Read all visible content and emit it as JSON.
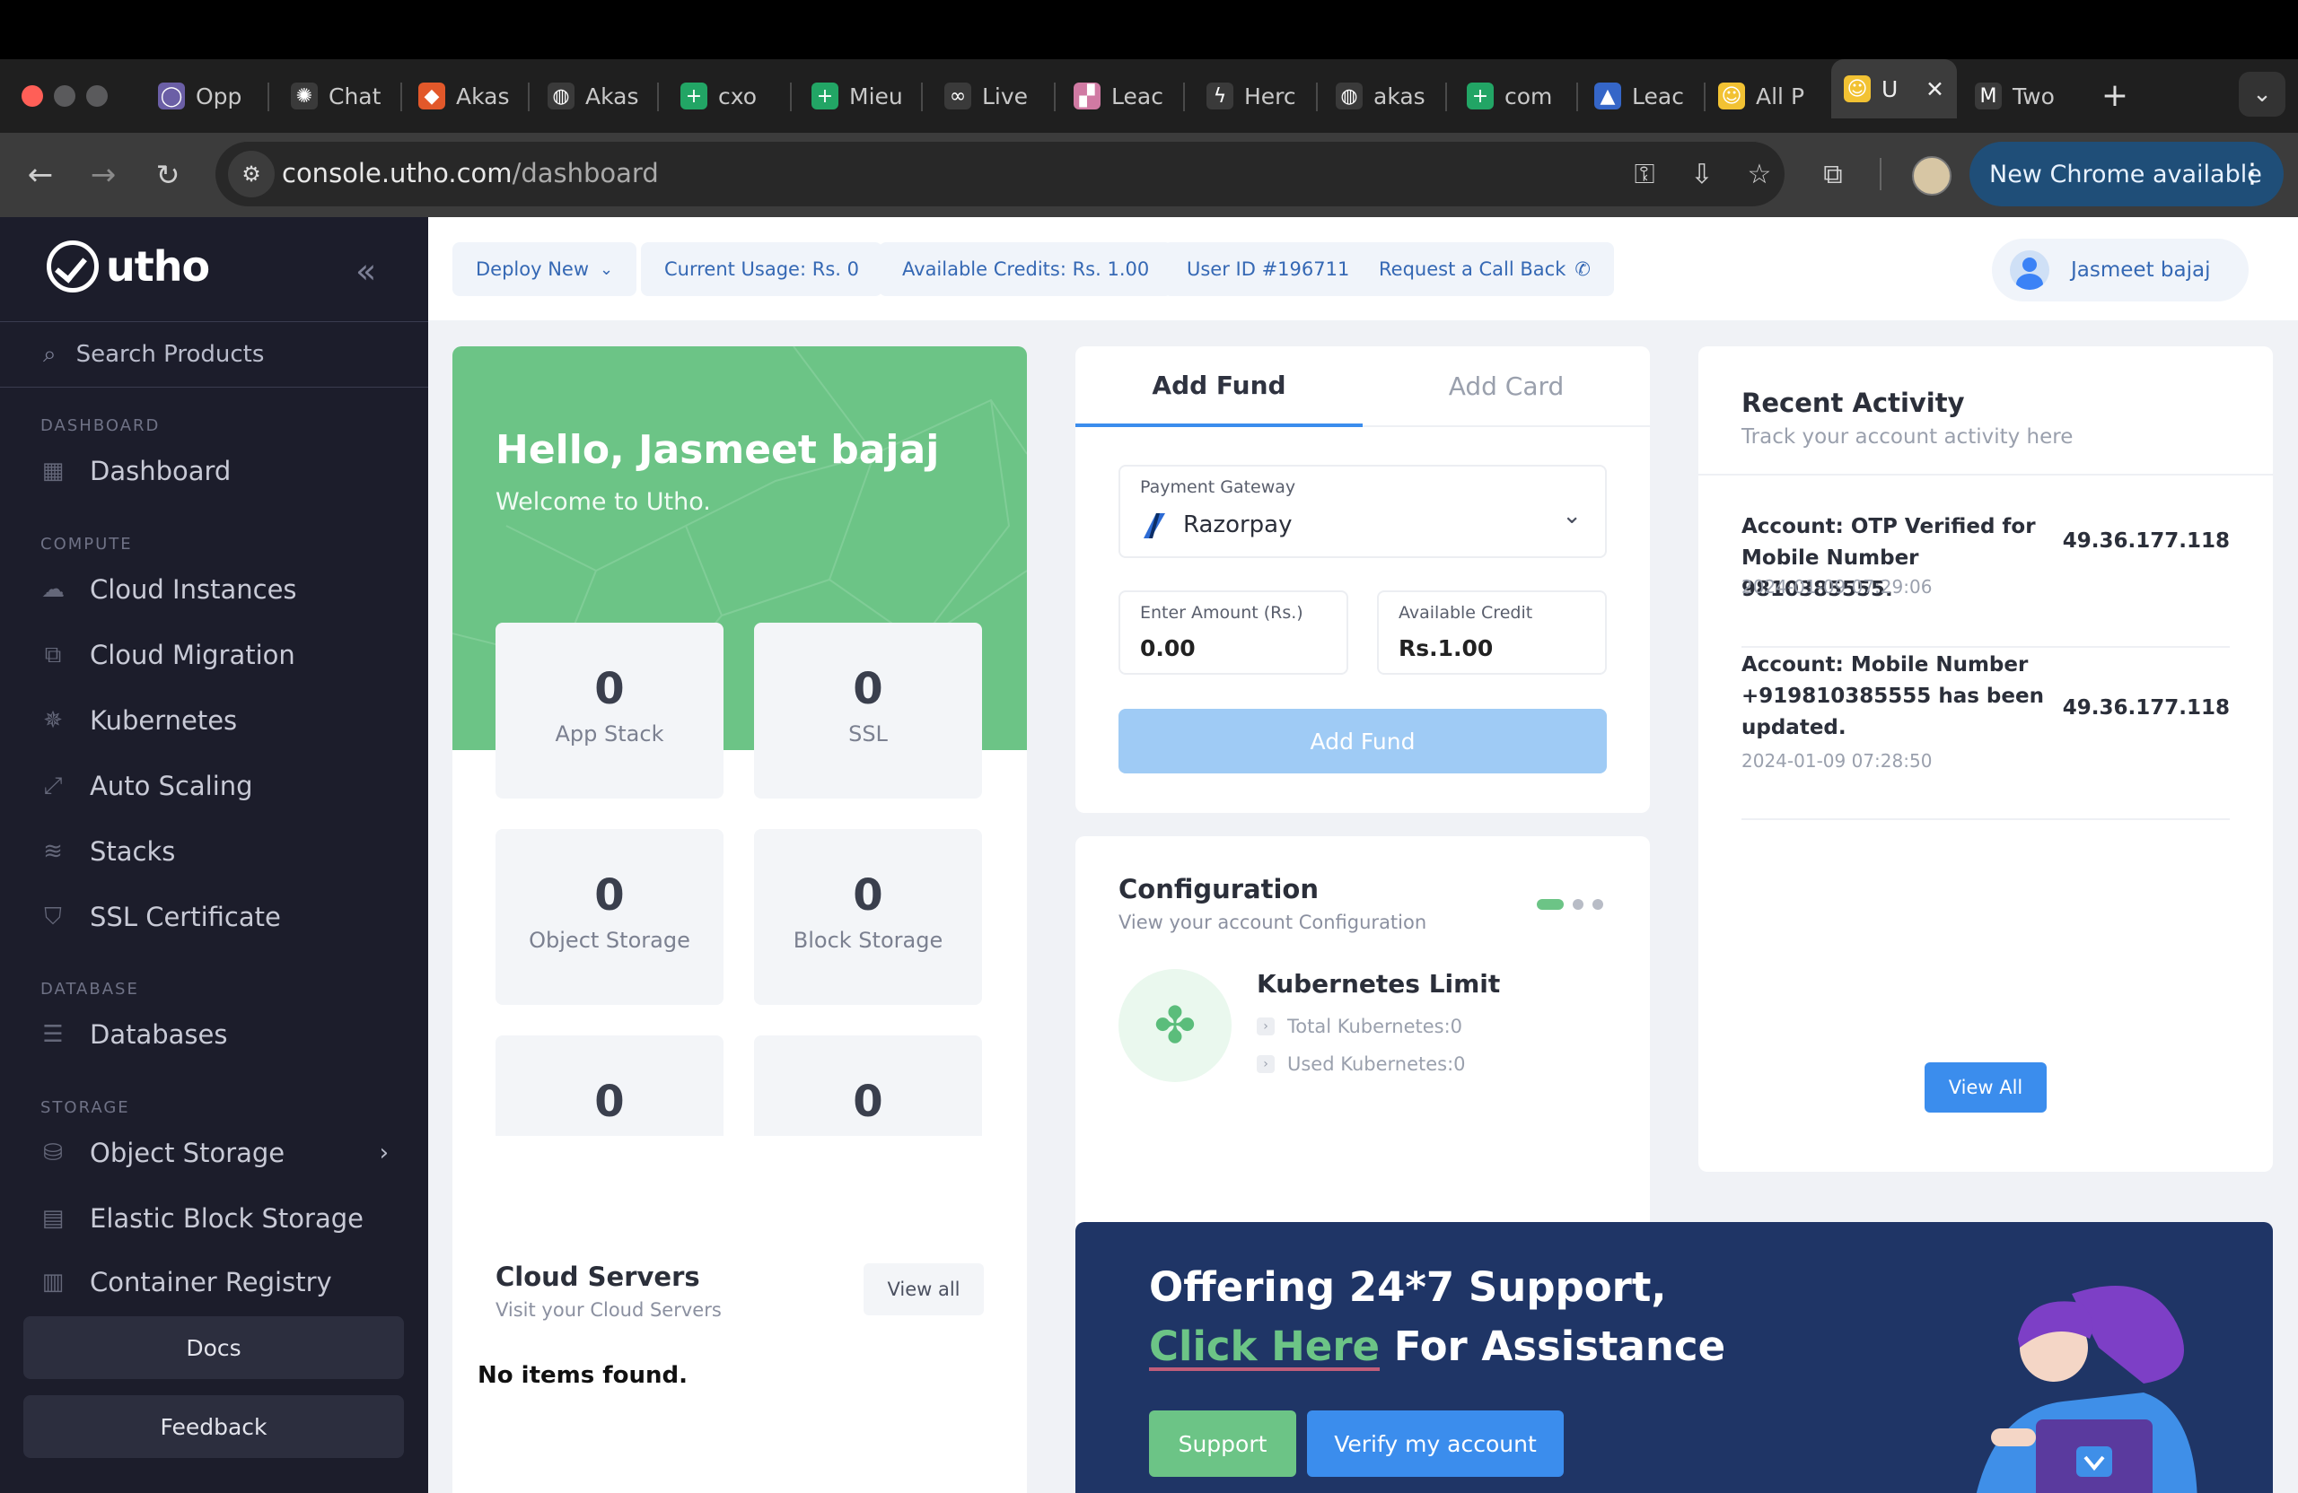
{
  "browser": {
    "tabs": [
      {
        "label": "Opp",
        "icon": "circle-app-icon",
        "color": "#6b5fa6"
      },
      {
        "label": "Chat",
        "icon": "openai-icon",
        "color": "#3a3a3a"
      },
      {
        "label": "Akas",
        "icon": "figma-icon",
        "color": "#e2582a"
      },
      {
        "label": "Akas",
        "icon": "globe-icon",
        "color": "#3a3a3a"
      },
      {
        "label": "cxo",
        "icon": "sheets-icon",
        "color": "#22a565"
      },
      {
        "label": "Mieu",
        "icon": "sheets-icon",
        "color": "#22a565"
      },
      {
        "label": "Live",
        "icon": "infinity-icon",
        "color": "#3a3a3a"
      },
      {
        "label": "Leac",
        "icon": "stack-icon",
        "color": "#d07aa3"
      },
      {
        "label": "Herc",
        "icon": "bolt-icon",
        "color": "#3a3a3a"
      },
      {
        "label": "akas",
        "icon": "globe-icon",
        "color": "#3a3a3a"
      },
      {
        "label": "com",
        "icon": "sheets-icon",
        "color": "#22a565"
      },
      {
        "label": "Leac",
        "icon": "triangle-icon",
        "color": "#3566c8"
      },
      {
        "label": "All P",
        "icon": "utho-icon",
        "color": "#f2c233"
      },
      {
        "label": "U",
        "icon": "utho-icon",
        "color": "#f2c233"
      },
      {
        "label": "Two",
        "icon": "gmail-icon",
        "color": "#3a3a3a"
      }
    ],
    "url_host": "console.utho.com",
    "url_path": "/dashboard",
    "update_label": "New Chrome available"
  },
  "sidebar": {
    "brand": "utho",
    "search_placeholder": "Search Products",
    "sections": {
      "dashboard": "DASHBOARD",
      "compute": "COMPUTE",
      "database": "DATABASE",
      "storage": "STORAGE"
    },
    "items": {
      "dashboard": "Dashboard",
      "cloud_instances": "Cloud Instances",
      "cloud_migration": "Cloud Migration",
      "kubernetes": "Kubernetes",
      "auto_scaling": "Auto Scaling",
      "stacks": "Stacks",
      "ssl_certificate": "SSL Certificate",
      "databases": "Databases",
      "object_storage": "Object Storage",
      "elastic_block_storage": "Elastic Block Storage",
      "container_registry": "Container Registry"
    },
    "docs": "Docs",
    "feedback": "Feedback"
  },
  "topbar": {
    "deploy": "Deploy New",
    "usage": "Current Usage: Rs. 0",
    "credits": "Available Credits: Rs. 1.00",
    "user_id": "User ID #196711",
    "callback": "Request a Call Back",
    "user": "Jasmeet bajaj"
  },
  "hello": {
    "title": "Hello, Jasmeet bajaj",
    "subtitle": "Welcome to Utho.",
    "stats": [
      {
        "value": "0",
        "label": "App Stack"
      },
      {
        "value": "0",
        "label": "SSL"
      },
      {
        "value": "0",
        "label": "Object Storage"
      },
      {
        "value": "0",
        "label": "Block Storage"
      },
      {
        "value": "0",
        "label": ""
      },
      {
        "value": "0",
        "label": ""
      }
    ]
  },
  "fund": {
    "tab_fund": "Add Fund",
    "tab_card": "Add Card",
    "gateway_label": "Payment Gateway",
    "gateway_value": "Razorpay",
    "amount_label": "Enter Amount (Rs.)",
    "amount_value": "0.00",
    "credit_label": "Available Credit",
    "credit_value": "Rs.1.00",
    "button": "Add Fund"
  },
  "config": {
    "title": "Configuration",
    "subtitle": "View your account Configuration",
    "limit_title": "Kubernetes Limit",
    "total": "Total Kubernetes:0",
    "used": "Used Kubernetes:0"
  },
  "activity": {
    "title": "Recent Activity",
    "subtitle": "Track your account activity here",
    "items": [
      {
        "text": "Account: OTP Verified for Mobile Number 9810385555.",
        "time": "2024-01-09 07:29:06",
        "ip": "49.36.177.118"
      },
      {
        "text": "Account: Mobile Number +919810385555 has been updated.",
        "time": "2024-01-09 07:28:50",
        "ip": "49.36.177.118"
      }
    ],
    "view_all": "View All"
  },
  "servers": {
    "title": "Cloud Servers",
    "subtitle": "Visit your Cloud Servers",
    "view_all": "View all",
    "empty": "No items found."
  },
  "support": {
    "line1": "Offering 24*7 Support,",
    "click_here": "Click Here",
    "line2_rest": " For Assistance",
    "btn_support": "Support",
    "btn_verify": "Verify my account"
  },
  "colors": {
    "sidebar_bg": "#1c1d2b",
    "accent_green": "#6cc486",
    "accent_blue": "#3b8ded",
    "banner_navy": "#1f3566"
  }
}
